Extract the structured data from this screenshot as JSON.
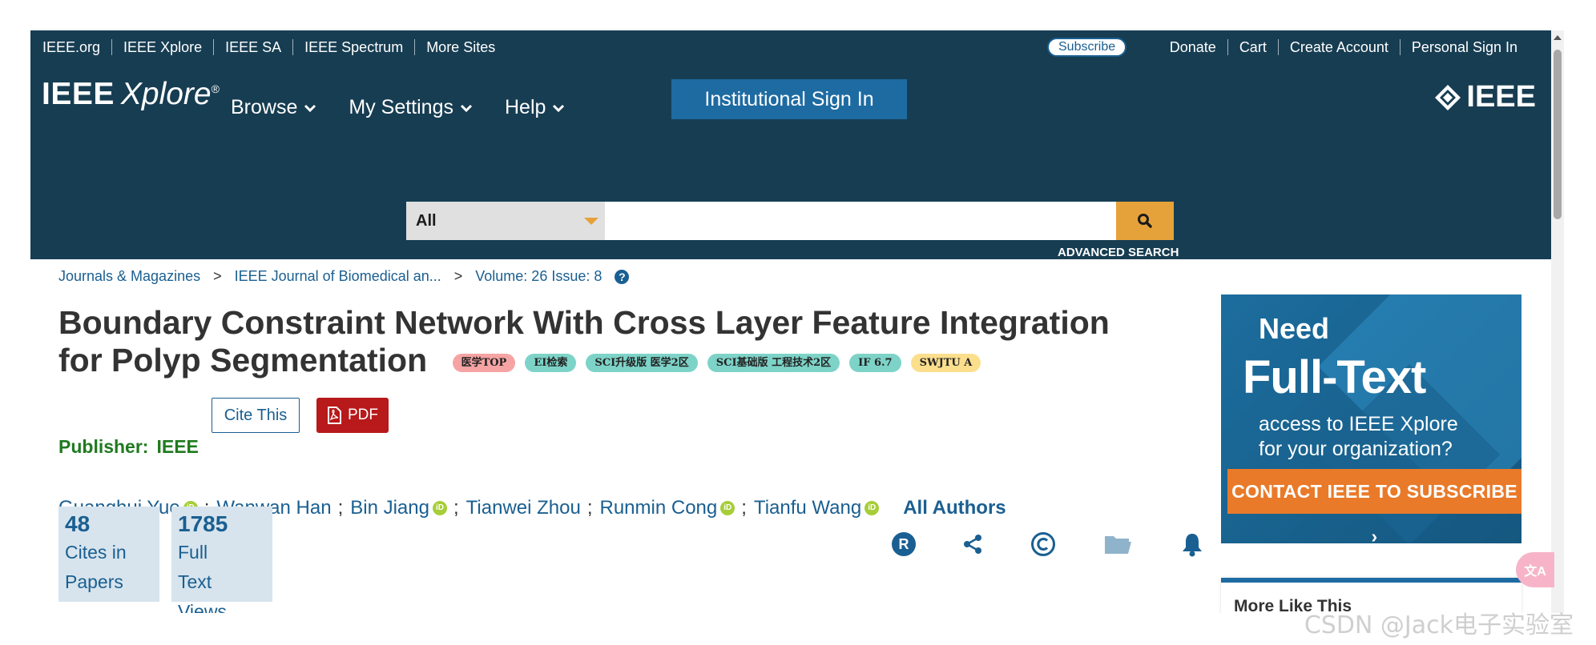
{
  "utility_bar": {
    "left_links": [
      "IEEE.org",
      "IEEE Xplore",
      "IEEE SA",
      "IEEE Spectrum",
      "More Sites"
    ],
    "subscribe": "Subscribe",
    "right_links": [
      "Donate",
      "Cart",
      "Create Account",
      "Personal Sign In"
    ]
  },
  "header": {
    "logo_a": "IEEE",
    "logo_b": "Xplore",
    "logo_reg": "®",
    "nav": [
      "Browse",
      "My Settings",
      "Help"
    ],
    "institutional_sign_in": "Institutional Sign In",
    "ieee_logo": "IEEE",
    "search": {
      "scope": "All",
      "placeholder": "",
      "advanced": "ADVANCED SEARCH"
    }
  },
  "breadcrumb": {
    "items": [
      "Journals & Magazines",
      "IEEE Journal of Biomedical an...",
      "Volume: 26 Issue: 8"
    ],
    "separator": ">"
  },
  "article": {
    "title_line1": "Boundary Constraint Network With Cross Layer Feature Integration",
    "title_line2": "for Polyp Segmentation",
    "badges": [
      "医学TOP",
      "EI检索",
      "SCI升级版 医学2区",
      "SCI基础版 工程技术2区",
      "IF 6.7",
      "SWJTU A"
    ],
    "publisher_label": "Publisher:",
    "publisher_name": "IEEE",
    "cite_button": "Cite This",
    "pdf_button": "PDF",
    "authors": [
      "Guanghui Yue",
      "Wanwan Han",
      "Bin Jiang",
      "Tianwei Zhou",
      "Runmin Cong",
      "Tianfu Wang"
    ],
    "author_sep": ";",
    "all_authors": "All Authors",
    "orcid_label": "iD",
    "metrics": [
      {
        "value": "48",
        "label_lines": [
          "Cites in",
          "Papers"
        ]
      },
      {
        "value": "1785",
        "label_lines": [
          "Full",
          "Text",
          "Views"
        ]
      }
    ],
    "action_icons": [
      "rights-icon",
      "share-icon",
      "copyright-icon",
      "folder-icon",
      "alert-bell-icon"
    ],
    "colors": {
      "link": "#1a5f91",
      "header_bg": "#173d52",
      "accent": "#e6a23a",
      "pdf_red": "#b8191b",
      "publisher_green": "#1f7a1f"
    }
  },
  "sidebar": {
    "ad": {
      "line1": "Need",
      "line2": "Full-Text",
      "line3a": "access to IEEE Xplore",
      "line3b": "for your organization?",
      "cta": "CONTACT IEEE TO SUBSCRIBE ›"
    },
    "more_like_this": "More Like This"
  },
  "watermark": "CSDN @Jack电子实验室",
  "translate_fab": "文A"
}
